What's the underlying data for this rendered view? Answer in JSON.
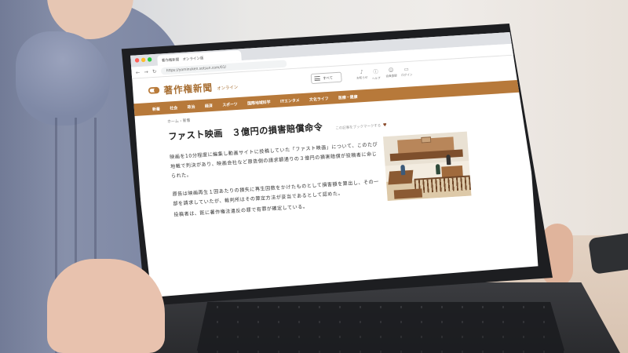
{
  "browser": {
    "tab_title": "著作権新聞　オンライン版",
    "url": "https://yominuken.sotsun.com/01/"
  },
  "site": {
    "logo_text": "著作権新聞",
    "logo_sub": "オンライン",
    "menu_label": "すべて",
    "utilities": [
      {
        "label": "お知らせ",
        "icon": "bell-icon"
      },
      {
        "label": "ヘルプ",
        "icon": "help-icon"
      },
      {
        "label": "会員登録",
        "icon": "user-plus-icon"
      },
      {
        "label": "ログイン",
        "icon": "login-icon"
      }
    ]
  },
  "nav": {
    "items": [
      "新着",
      "社会",
      "政治",
      "経済",
      "スポーツ",
      "国際地域科学",
      "ITエンタメ",
      "文化ライフ",
      "医療・健康"
    ]
  },
  "article": {
    "breadcrumb": "ホーム › 新着",
    "headline": "ファスト映画　３億円の損害賠償命令",
    "bookmark_label": "この記事をブックマークする",
    "paragraphs": [
      "映画を10分程度に編集し動画サイトに投稿していた「ファスト映画」について、このたび地裁で判決があり、映画会社など原告側の請求額通りの３億円の損害賠償が投稿者に命じられた。",
      "原告は映画再生１回あたりの損失に再生回数をかけたものとして損害額を算出し、その一部を請求していたが、裁判所はその算定方法が妥当であるとして認めた。",
      "投稿者は、既に著作権法違反の罪で有罪が確定している。"
    ]
  },
  "colors": {
    "brand": "#b7793a",
    "logo": "#a86f33"
  }
}
